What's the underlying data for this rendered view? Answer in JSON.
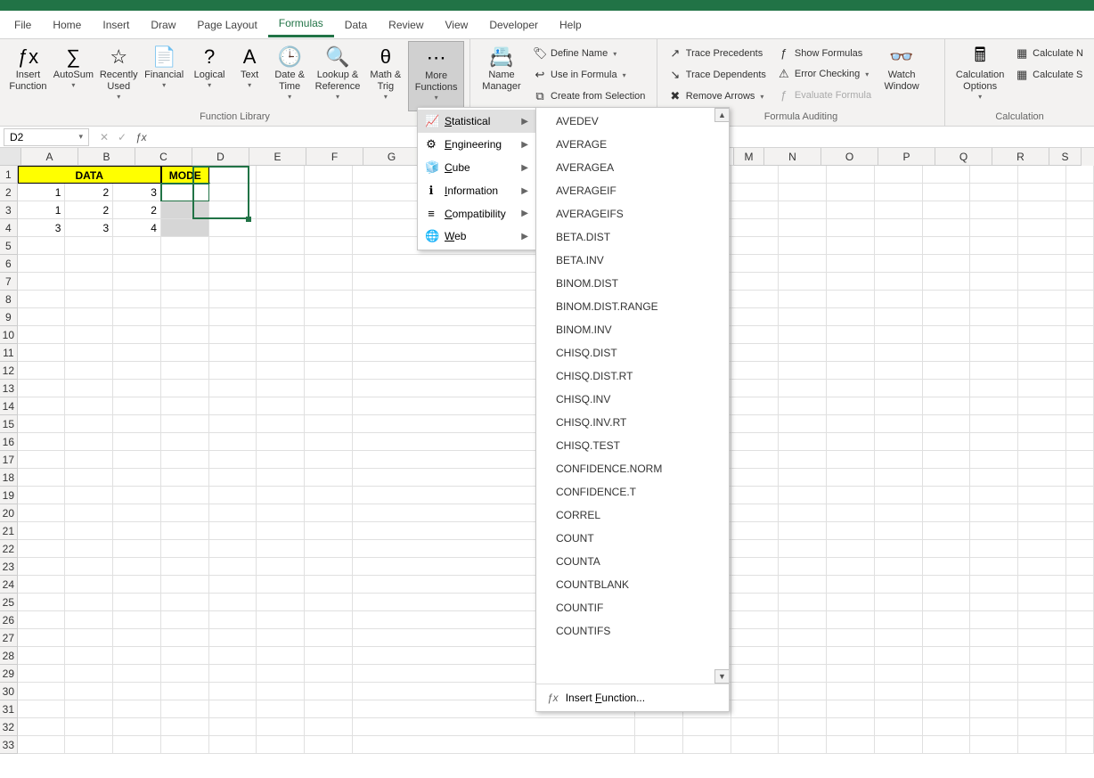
{
  "tabs": [
    "File",
    "Home",
    "Insert",
    "Draw",
    "Page Layout",
    "Formulas",
    "Data",
    "Review",
    "View",
    "Developer",
    "Help"
  ],
  "active_tab": "Formulas",
  "ribbon": {
    "function_library": {
      "label": "Function Library",
      "insert_function": "Insert Function",
      "autosum": "AutoSum",
      "recently_used": "Recently Used",
      "financial": "Financial",
      "logical": "Logical",
      "text": "Text",
      "date_time": "Date & Time",
      "lookup_reference": "Lookup & Reference",
      "math_trig": "Math & Trig",
      "more_functions": "More Functions"
    },
    "defined_names": {
      "label": "",
      "name_manager": "Name Manager",
      "define_name": "Define Name",
      "use_in_formula": "Use in Formula",
      "create_from_selection": "Create from Selection"
    },
    "formula_auditing": {
      "label": "Formula Auditing",
      "trace_precedents": "Trace Precedents",
      "trace_dependents": "Trace Dependents",
      "remove_arrows": "Remove Arrows",
      "show_formulas": "Show Formulas",
      "error_checking": "Error Checking",
      "evaluate_formula": "Evaluate Formula",
      "watch_window": "Watch Window"
    },
    "calculation": {
      "label": "Calculation",
      "calculation_options": "Calculation Options",
      "calculate_now": "Calculate N",
      "calculate_sheet": "Calculate S"
    }
  },
  "name_box": "D2",
  "more_functions_menu": [
    {
      "label": "Statistical",
      "u": "S",
      "active": true
    },
    {
      "label": "Engineering",
      "u": "E"
    },
    {
      "label": "Cube",
      "u": "C"
    },
    {
      "label": "Information",
      "u": "I"
    },
    {
      "label": "Compatibility",
      "u": "C"
    },
    {
      "label": "Web",
      "u": "W"
    }
  ],
  "statistical_functions": [
    "AVEDEV",
    "AVERAGE",
    "AVERAGEA",
    "AVERAGEIF",
    "AVERAGEIFS",
    "BETA.DIST",
    "BETA.INV",
    "BINOM.DIST",
    "BINOM.DIST.RANGE",
    "BINOM.INV",
    "CHISQ.DIST",
    "CHISQ.DIST.RT",
    "CHISQ.INV",
    "CHISQ.INV.RT",
    "CHISQ.TEST",
    "CONFIDENCE.NORM",
    "CONFIDENCE.T",
    "CORREL",
    "COUNT",
    "COUNTA",
    "COUNTBLANK",
    "COUNTIF",
    "COUNTIFS"
  ],
  "insert_function_label": "Insert Function...",
  "columns": [
    "A",
    "B",
    "C",
    "D",
    "E",
    "F",
    "G",
    "M",
    "N",
    "O",
    "P",
    "Q",
    "R",
    "S"
  ],
  "sheet": {
    "header_data": "DATA",
    "header_mode": "MODE",
    "rows": [
      [
        "1",
        "2",
        "3",
        ""
      ],
      [
        "1",
        "2",
        "2",
        ""
      ],
      [
        "3",
        "3",
        "4",
        ""
      ]
    ]
  },
  "icons": {
    "fx": "ƒx",
    "sum": "∑",
    "clock": "🕒",
    "star": "☆",
    "dollar": "$",
    "question": "?",
    "letterA": "A",
    "lookup": "🔍",
    "theta": "θ",
    "dots": "⋯",
    "tag": "🏷"
  }
}
